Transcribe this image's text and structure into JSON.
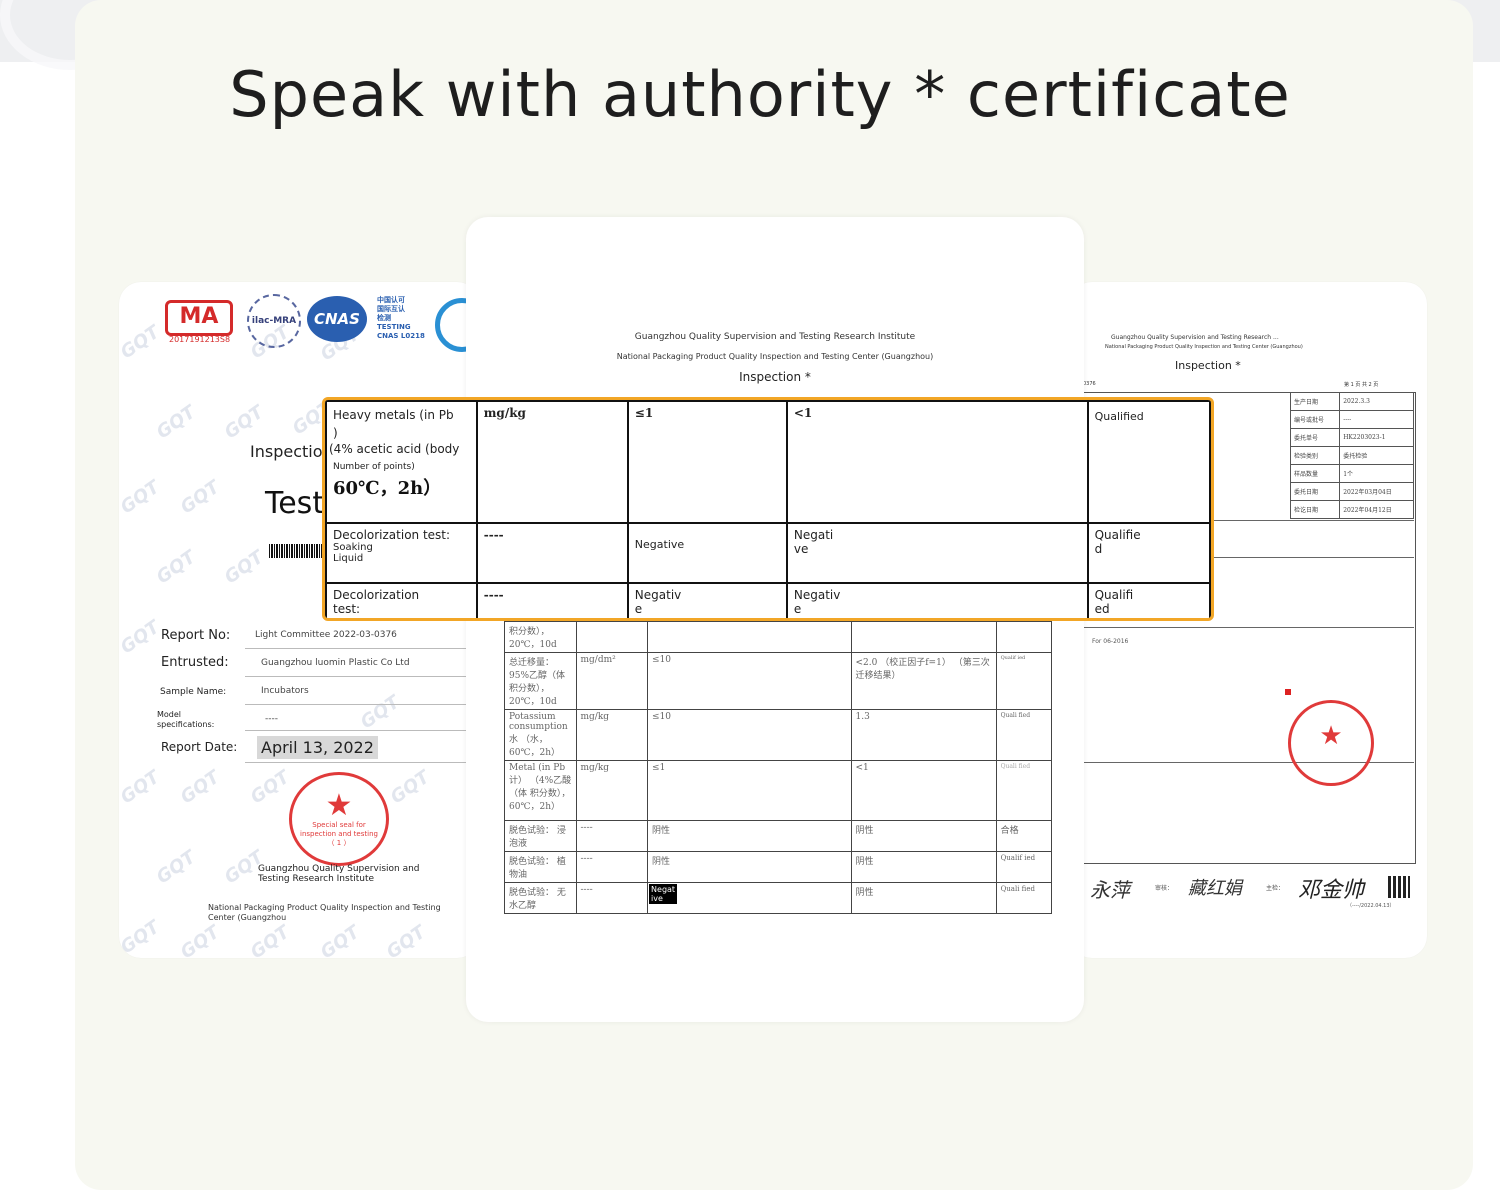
{
  "headline": "Speak with authority * certificate",
  "left_card": {
    "cma_text": "MA",
    "cma_number": "2017191213S8",
    "ilac_text": "ilac-MRA",
    "cnas_text": "CNAS",
    "cnas_side_text": [
      "中国认可",
      "国际互认",
      "检测",
      "TESTING",
      "CNAS L0218"
    ],
    "watermark": "GQT",
    "inspection_label": "Inspection",
    "test_label": "Test",
    "fields": [
      {
        "label": "Report No:",
        "value": "Light Committee 2022-03-0376"
      },
      {
        "label": "Entrusted:",
        "value": "Guangzhou luomin Plastic Co Ltd"
      },
      {
        "label": "Sample Name:",
        "value": "Incubators"
      },
      {
        "label": "Model specifications:",
        "value": "----"
      },
      {
        "label": "Report Date:",
        "value": "April 13, 2022"
      }
    ],
    "seal_text": [
      "Special seal for",
      "inspection and testing",
      "（ 1 ）"
    ],
    "institute": "Guangzhou Quality Supervision and Testing Research Institute",
    "center": "National Packaging Product Quality Inspection and Testing Center (Guangzhou"
  },
  "center_card": {
    "institute": "Guangzhou Quality Supervision and Testing Research Institute",
    "center": "National Packaging Product Quality Inspection and Testing Center (Guangzhou)",
    "title": "Inspection *",
    "rows": [
      {
        "item": "积分数）， 20℃，10d",
        "unit": "",
        "std": "",
        "result": "",
        "verdict": ""
      },
      {
        "item": "总迁移量： 95%乙醇（体 积分数）， 20℃，10d",
        "unit": "mg/dm²",
        "std": "≤10",
        "result": "<2.0 （校正因子f=1） （第三次迁移结果）",
        "verdict": "Qualif ied"
      },
      {
        "item": "Potassium consumption 水 （水， 60℃，2h）",
        "unit": "mg/kg",
        "std": "≤10",
        "result": "1.3",
        "verdict": "Quali fied"
      },
      {
        "item": "Metal (in Pb 计） （4%乙酸（体 积分数）， 60℃，2h）",
        "unit": "mg/kg",
        "std": "≤1",
        "result": "<1",
        "verdict": "Quali fied"
      },
      {
        "item": "脱色试验： 浸泡液",
        "unit": "----",
        "std": "阴性",
        "result": "阴性",
        "verdict": "合格"
      },
      {
        "item": "脱色试验： 植物油",
        "unit": "----",
        "std": "阴性",
        "result": "阴性",
        "verdict": "Qualif ied"
      },
      {
        "item": "脱色试验： 无水乙醇",
        "unit": "----",
        "std": "Negat ive",
        "result": "阴性",
        "verdict": "Quali fied"
      }
    ]
  },
  "highlight": {
    "row1": {
      "item_a": "Heavy metals (in Pb",
      "item_b": ")",
      "item_c": "(4% acetic acid (body",
      "item_d": "Number of points)",
      "item_e": "60℃，2h）",
      "unit": "mg/kg",
      "std": "≤1",
      "result": "<1",
      "verdict": "Qualified"
    },
    "row2": {
      "item_a": "Decolorization test:",
      "item_b": "Soaking Liquid",
      "unit": "----",
      "std": "Negative",
      "result": "Negati ve",
      "verdict": "Qualifie d"
    },
    "row3": {
      "item_a": "Decolorization test:",
      "unit": "----",
      "std": "Negativ e",
      "result": "Negativ e",
      "verdict": "Qualifi ed"
    }
  },
  "right_card": {
    "institute": "Guangzhou Quality Supervision and Testing Research ...",
    "center": "National Packaging Product Quality Inspection and Testing Center (Guangzhou)",
    "title": "Inspection *",
    "report_no": "0376",
    "page_info": "第 1 页 共 2 页",
    "info_rows": [
      {
        "k": "生产日期",
        "v": "2022.3.3"
      },
      {
        "k": "编号或批号",
        "v": "----"
      },
      {
        "k": "委托单号",
        "v": "HK2203023-1"
      },
      {
        "k": "检验类别",
        "v": "委托检验"
      },
      {
        "k": "样品数量",
        "v": "1个"
      },
      {
        "k": "委托日期",
        "v": "2022年03月04日"
      },
      {
        "k": "检讫日期",
        "v": "2022年04月12日"
      }
    ],
    "standard_note": "For 06-2016",
    "signers": {
      "approver_label": "审核：",
      "main_label": "主检："
    },
    "date_line": "（----/2022.04.13）"
  }
}
